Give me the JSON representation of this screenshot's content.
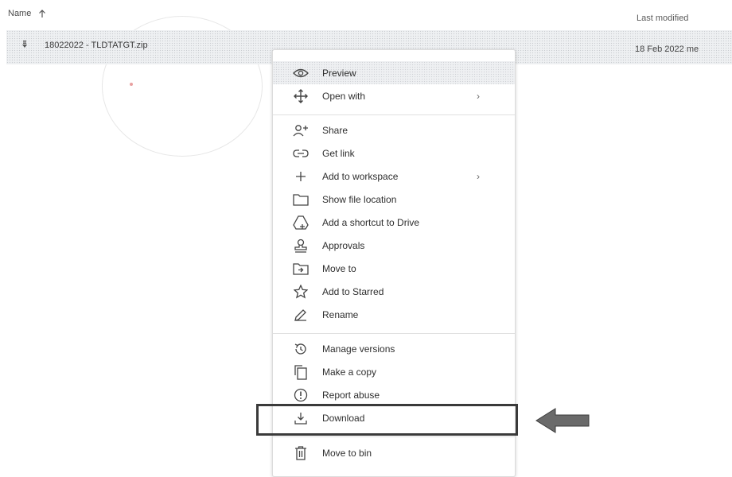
{
  "header": {
    "name_label": "Name",
    "modified_label": "Last modified"
  },
  "file": {
    "name": "18022022 - TLDTATGT.zip",
    "modified": "18 Feb 2022 me"
  },
  "menu": {
    "items": [
      {
        "label": "Preview",
        "icon": "eye-icon"
      },
      {
        "label": "Open with",
        "icon": "move-arrows-icon",
        "submenu": true
      },
      {
        "label": "Share",
        "icon": "person-add-icon"
      },
      {
        "label": "Get link",
        "icon": "link-icon"
      },
      {
        "label": "Add to workspace",
        "icon": "plus-icon",
        "submenu": true
      },
      {
        "label": "Show file location",
        "icon": "folder-icon"
      },
      {
        "label": "Add a shortcut to Drive",
        "icon": "drive-shortcut-icon"
      },
      {
        "label": "Approvals",
        "icon": "approval-stamp-icon"
      },
      {
        "label": "Move to",
        "icon": "folder-move-icon"
      },
      {
        "label": "Add to Starred",
        "icon": "star-icon"
      },
      {
        "label": "Rename",
        "icon": "pencil-icon"
      },
      {
        "label": "Manage versions",
        "icon": "history-icon"
      },
      {
        "label": "Make a copy",
        "icon": "copy-icon"
      },
      {
        "label": "Report abuse",
        "icon": "alert-icon"
      },
      {
        "label": "Download",
        "icon": "download-icon"
      },
      {
        "label": "Move to bin",
        "icon": "trash-icon"
      }
    ],
    "submenu_glyph": "›"
  },
  "colors": {
    "highlight_row": "#eef0f2",
    "annotation": "#3a3a3a"
  }
}
